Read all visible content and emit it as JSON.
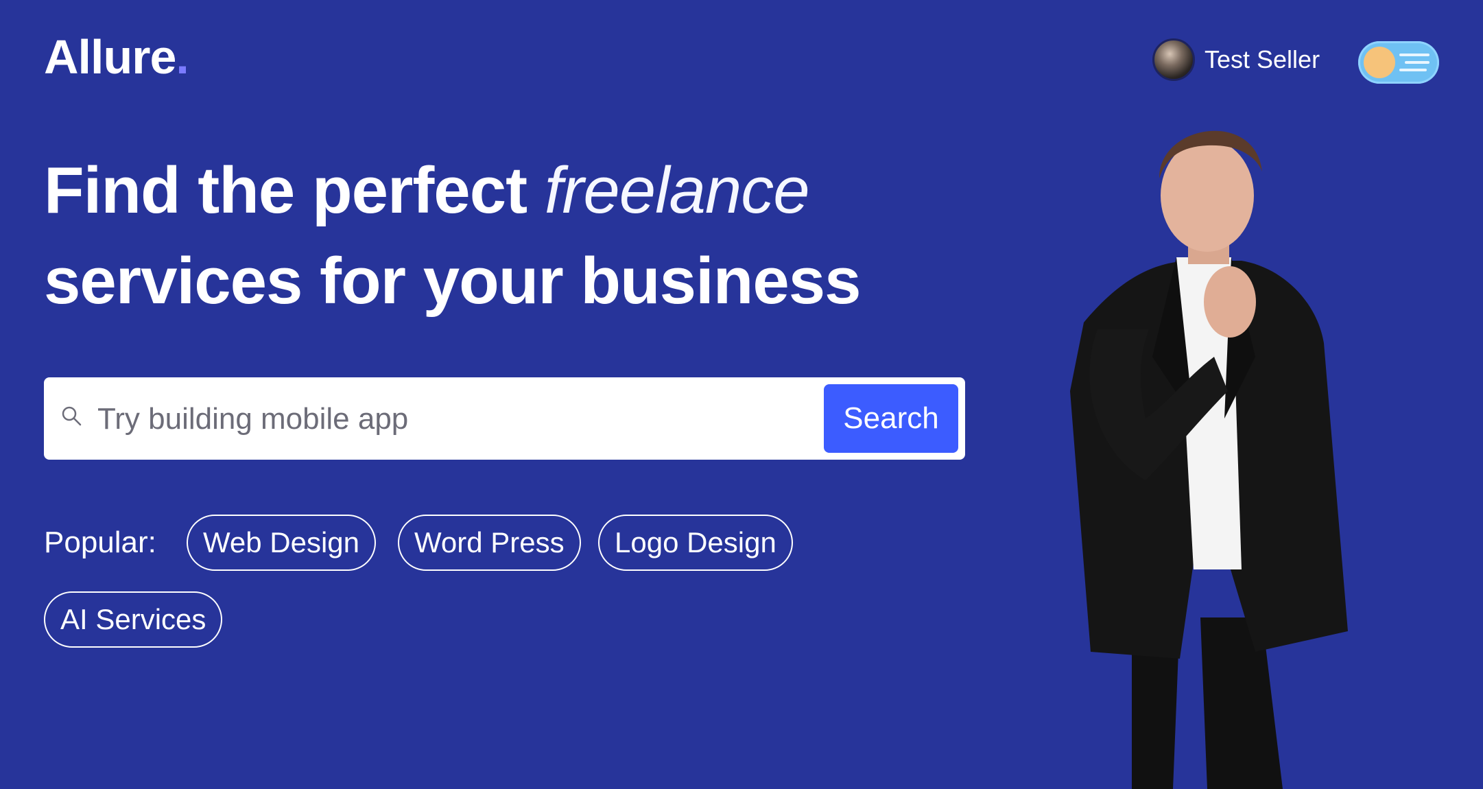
{
  "brand": {
    "name": "Allure",
    "dot": ".",
    "accent_color": "#7b7bff"
  },
  "header": {
    "user_name": "Test Seller",
    "avatar_icon": "avatar",
    "theme_toggle_icon": "sun-toggle-icon"
  },
  "hero": {
    "line1_start": "Find the perfect ",
    "line1_accent": "freelance",
    "line2": "services for your business"
  },
  "search": {
    "placeholder": "Try building mobile app",
    "value": "",
    "button_label": "Search",
    "icon": "search-icon"
  },
  "popular": {
    "label": "Popular:",
    "tags": [
      "Web Design",
      "Word Press",
      "Logo Design",
      "AI Services"
    ]
  },
  "colors": {
    "background": "#27349a",
    "primary": "#3c5cff",
    "toggle": "#6fc1f3",
    "toggle_knob": "#f6c37a"
  }
}
